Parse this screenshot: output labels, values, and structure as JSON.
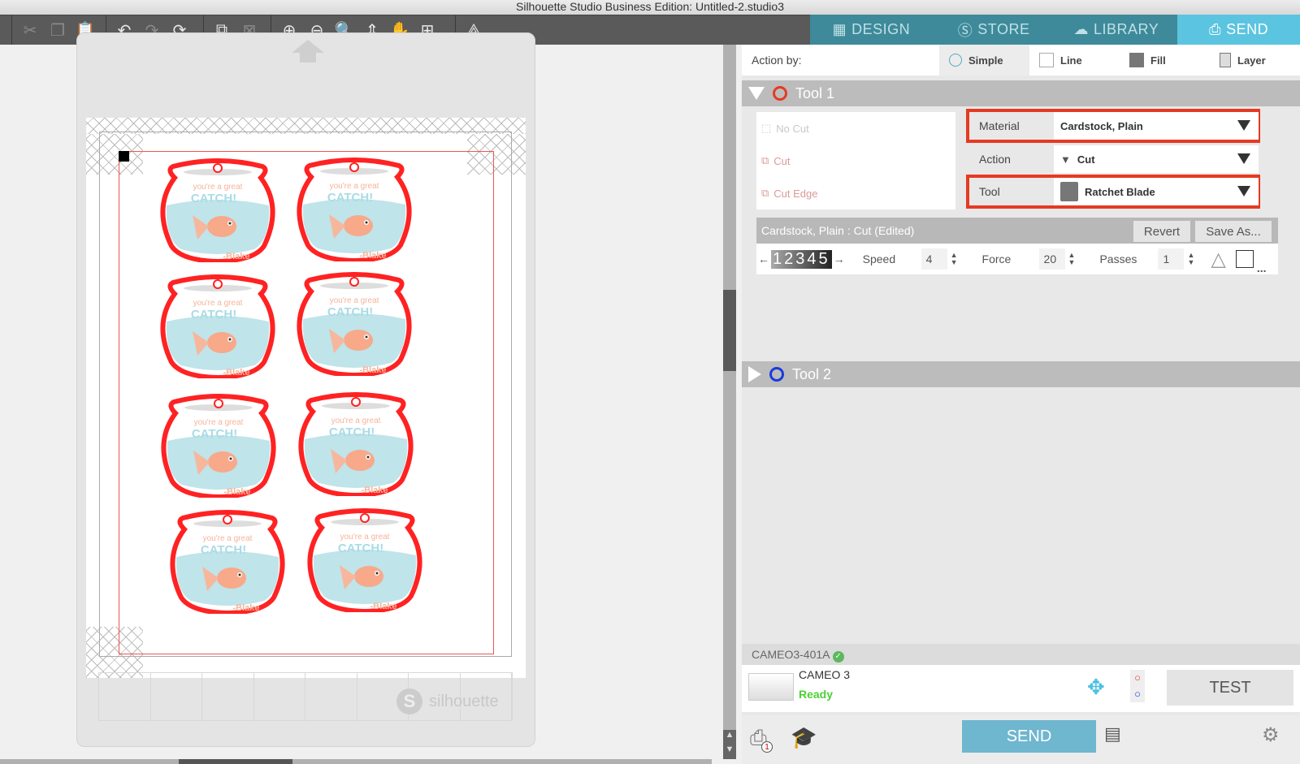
{
  "window": {
    "title": "Silhouette Studio Business Edition: Untitled-2.studio3"
  },
  "toolbar": {
    "groups": [
      [
        "cut-icon",
        "copy-icon",
        "paste-icon"
      ],
      [
        "undo-icon",
        "redo-icon",
        "rotate-icon"
      ],
      [
        "group-icon",
        "ungroup-icon"
      ],
      [
        "zoom-in-icon",
        "zoom-out-icon",
        "zoom-select-icon",
        "move-page-icon",
        "pan-hand-icon",
        "fit-page-icon"
      ],
      [
        "print-cut-icon"
      ]
    ]
  },
  "nav_tabs": [
    {
      "label": "DESIGN",
      "icon": "grid-icon",
      "active": false
    },
    {
      "label": "STORE",
      "icon": "silhouette-s-icon",
      "active": false
    },
    {
      "label": "LIBRARY",
      "icon": "cloud-download-icon",
      "active": false
    },
    {
      "label": "SEND",
      "icon": "cutter-icon",
      "active": true
    }
  ],
  "action_by": {
    "label": "Action by:",
    "options": [
      {
        "label": "Simple",
        "selected": true
      },
      {
        "label": "Line",
        "selected": false
      },
      {
        "label": "Fill",
        "selected": false
      },
      {
        "label": "Layer",
        "selected": false
      }
    ]
  },
  "tool1": {
    "title": "Tool 1",
    "color": "#e53a22",
    "cut_options": [
      "No Cut",
      "Cut",
      "Cut Edge"
    ],
    "material": {
      "label": "Material",
      "value": "Cardstock, Plain"
    },
    "action": {
      "label": "Action",
      "value": "Cut"
    },
    "tool": {
      "label": "Tool",
      "value": "Ratchet Blade"
    },
    "preset_name": "Cardstock, Plain : Cut (Edited)",
    "revert_label": "Revert",
    "save_as_label": "Save As...",
    "blade_digits": "12345",
    "speed": {
      "label": "Speed",
      "value": "4"
    },
    "force": {
      "label": "Force",
      "value": "20"
    },
    "passes": {
      "label": "Passes",
      "value": "1"
    },
    "more_label": "..."
  },
  "tool2": {
    "title": "Tool 2",
    "color": "#1a3adf"
  },
  "device": {
    "id": "CAMEO3-401A",
    "name": "CAMEO 3",
    "status": "Ready",
    "status_color": "#4cd137",
    "test_label": "TEST"
  },
  "bottom": {
    "send_label": "SEND",
    "queue_count": "1"
  },
  "canvas": {
    "card": {
      "line1": "you're a great",
      "line2": "CATCH!",
      "signature": "-Blake"
    },
    "card_count": 8,
    "logo_text": "silhouette"
  }
}
